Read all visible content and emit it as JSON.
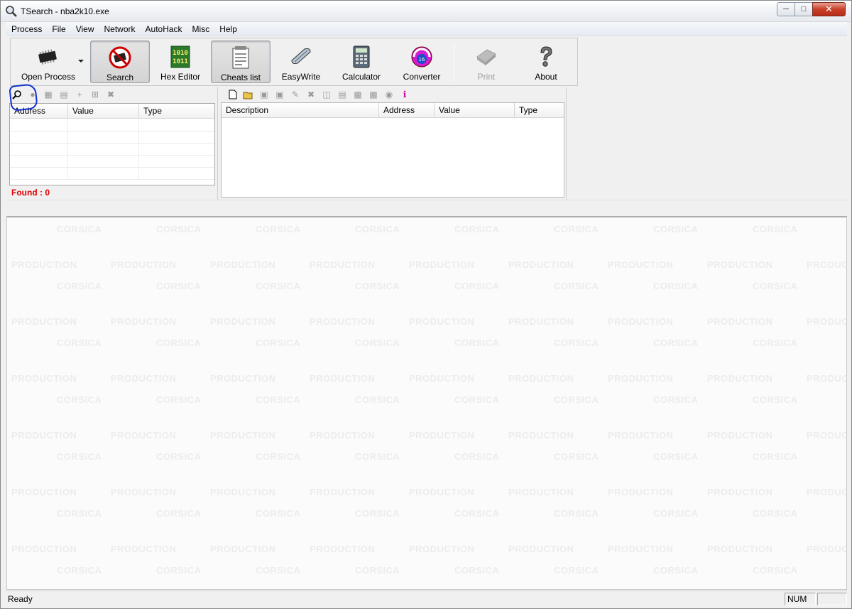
{
  "window": {
    "title": "TSearch - nba2k10.exe"
  },
  "menu": [
    "Process",
    "File",
    "View",
    "Network",
    "AutoHack",
    "Misc",
    "Help"
  ],
  "toolbar": {
    "open_process": "Open Process",
    "search": "Search",
    "hex_editor": "Hex Editor",
    "cheats_list": "Cheats list",
    "easywrite": "EasyWrite",
    "calculator": "Calculator",
    "converter": "Converter",
    "print": "Print",
    "about": "About"
  },
  "search_panel": {
    "columns": [
      "Address",
      "Value",
      "Type"
    ],
    "found_text": "Found : 0"
  },
  "cheats_panel": {
    "columns": [
      "Description",
      "Address",
      "Value",
      "Type"
    ]
  },
  "watermark": {
    "line1": "CORSICA",
    "line2": "PRODUCTION"
  },
  "statusbar": {
    "text": "Ready",
    "num": "NUM"
  }
}
